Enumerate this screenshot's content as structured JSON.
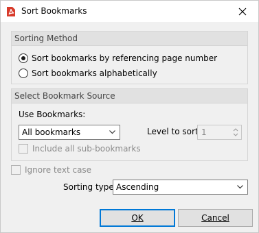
{
  "window": {
    "title": "Sort Bookmarks",
    "close_icon": "close-icon",
    "app_icon": "pdf-app-icon",
    "accent": "#0078d7",
    "app_icon_color": "#d83b2b"
  },
  "sorting_method": {
    "header": "Sorting Method",
    "options": [
      {
        "label": "Sort bookmarks by referencing page number",
        "selected": true
      },
      {
        "label": "Sort bookmarks alphabetically",
        "selected": false
      }
    ]
  },
  "source": {
    "header": "Select Bookmark Source",
    "use_label": "Use Bookmarks:",
    "use_value": "All bookmarks",
    "level_label": "Level to sort:",
    "level_value": "1",
    "include_sub_label": "Include all sub-bookmarks",
    "include_sub_checked": false
  },
  "ignore_case": {
    "label": "Ignore text case",
    "checked": false
  },
  "sorting_type": {
    "label": "Sorting type:",
    "value": "Ascending"
  },
  "buttons": {
    "ok_label": "OK",
    "cancel_label": "Cancel"
  }
}
